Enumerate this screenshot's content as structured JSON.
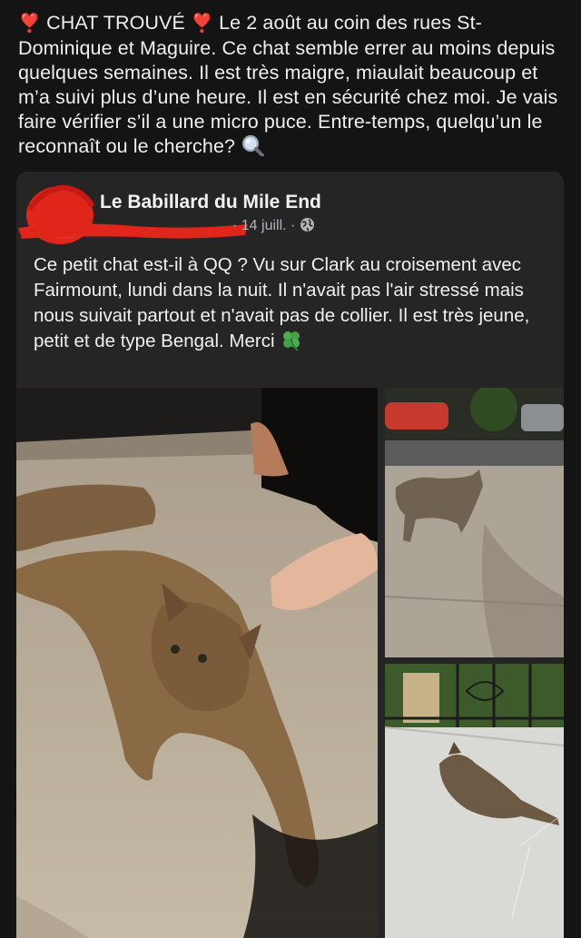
{
  "post": {
    "heart_emoji": "❣️",
    "heading": "CHAT TROUVÉ",
    "body": "Le 2 août au coin des rues St-Dominique et Maguire. Ce chat semble errer au moins depuis quelques semaines. Il est très maigre, miaulait beaucoup et m’a suivi plus d’une heure. Il est en sécurité chez moi. Je vais faire vérifier s’il a une micro puce. Entre-temps, quelqu’un le reconnaît ou le cherche?",
    "search_emoji": "magnifying-glass-icon"
  },
  "shared_post": {
    "page_name": "Le Babillard du Mile End",
    "date": "14 juill.",
    "separator": "·",
    "privacy_icon": "globe-icon",
    "text": "Ce petit chat est-il à QQ ? Vu sur Clark au croisement avec Fairmount, lundi dans la nuit. Il n'avait pas l'air stressé mais nous suivait partout et n'avait pas de collier. Il est très jeune, petit et de type Bengal. Merci",
    "end_emoji": "four-leaf-clover-icon",
    "photos": [
      {
        "name": "cat-lying-on-sidewalk-photo"
      },
      {
        "name": "cat-walking-on-street-photo"
      },
      {
        "name": "cat-on-balcony-photo"
      }
    ]
  },
  "colors": {
    "background": "#141414",
    "card": "#252526",
    "text": "#ececec",
    "muted": "#b0b3b8",
    "redaction": "#e0251b"
  }
}
